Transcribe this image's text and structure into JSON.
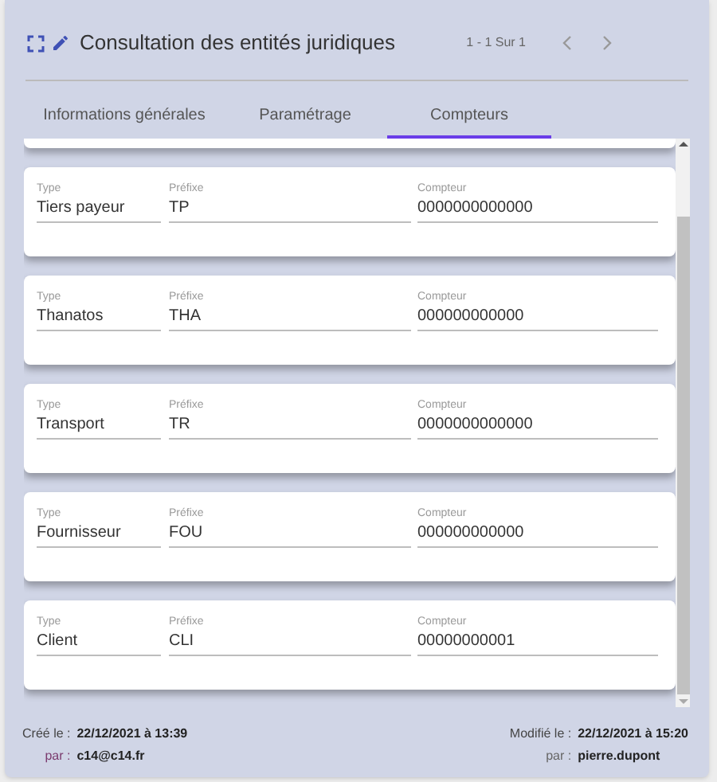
{
  "header": {
    "title": "Consultation des entités juridiques",
    "pagination": "1 - 1 Sur 1"
  },
  "tabs": [
    {
      "label": "Informations générales",
      "selected": false
    },
    {
      "label": "Paramétrage",
      "selected": false
    },
    {
      "label": "Compteurs",
      "selected": true
    }
  ],
  "counters": [
    {
      "type_label": "Type",
      "type": "Tiers payeur",
      "prefix_label": "Préfixe",
      "prefix": "TP",
      "counter_label": "Compteur",
      "counter": "0000000000000"
    },
    {
      "type_label": "Type",
      "type": "Thanatos",
      "prefix_label": "Préfixe",
      "prefix": "THA",
      "counter_label": "Compteur",
      "counter": "000000000000"
    },
    {
      "type_label": "Type",
      "type": "Transport",
      "prefix_label": "Préfixe",
      "prefix": "TR",
      "counter_label": "Compteur",
      "counter": "0000000000000"
    },
    {
      "type_label": "Type",
      "type": "Fournisseur",
      "prefix_label": "Préfixe",
      "prefix": "FOU",
      "counter_label": "Compteur",
      "counter": "000000000000"
    },
    {
      "type_label": "Type",
      "type": "Client",
      "prefix_label": "Préfixe",
      "prefix": "CLI",
      "counter_label": "Compteur",
      "counter": "00000000001"
    }
  ],
  "footer": {
    "created_label": "Créé le :",
    "created": "22/12/2021 à 13:39",
    "created_by_label": "par :",
    "created_by": "c14@c14.fr",
    "modified_label": "Modifié le :",
    "modified": "22/12/2021 à 15:20",
    "modified_by_label": "par :",
    "modified_by": "pierre.dupont"
  }
}
